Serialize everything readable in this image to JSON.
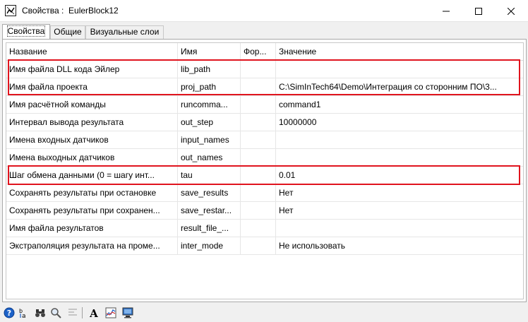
{
  "window": {
    "title": "Свойства :  EulerBlock12"
  },
  "tabs": [
    {
      "label": "Свойства"
    },
    {
      "label": "Общие"
    },
    {
      "label": "Визуальные слои"
    }
  ],
  "grid": {
    "columns": [
      "Название",
      "Имя",
      "Фор...",
      "Значение"
    ],
    "rows": [
      {
        "title": "Имя файла DLL кода Эйлер",
        "name": "lib_path",
        "formula": "",
        "value": ""
      },
      {
        "title": "Имя файла проекта",
        "name": "proj_path",
        "formula": "",
        "value": "C:\\SimInTech64\\Demo\\Интеграция со сторонним ПО\\3..."
      },
      {
        "title": "Имя расчётной команды",
        "name": "runcomma...",
        "formula": "",
        "value": "command1"
      },
      {
        "title": "Интервал вывода результата",
        "name": "out_step",
        "formula": "",
        "value": "10000000"
      },
      {
        "title": "Имена входных датчиков",
        "name": "input_names",
        "formula": "",
        "value": ""
      },
      {
        "title": "Имена выходных датчиков",
        "name": "out_names",
        "formula": "",
        "value": ""
      },
      {
        "title": "Шаг обмена данными (0 = шагу инт...",
        "name": "tau",
        "formula": "",
        "value": "0.01"
      },
      {
        "title": "Сохранять результаты при остановке",
        "name": "save_results",
        "formula": "",
        "value": "Нет"
      },
      {
        "title": "Сохранять результаты при сохранен...",
        "name": "save_restar...",
        "formula": "",
        "value": "Нет"
      },
      {
        "title": "Имя файла результатов",
        "name": "result_file_...",
        "formula": "",
        "value": ""
      },
      {
        "title": "Экстраполяция результата на проме...",
        "name": "inter_mode",
        "formula": "",
        "value": "Не использовать"
      }
    ]
  },
  "highlight_color": "#e0141e",
  "toolbar": {
    "icons": [
      "help-icon",
      "sort-az-icon",
      "binoculars-icon",
      "magnifier-icon",
      "font-icon",
      "chart-icon",
      "monitor-icon"
    ]
  }
}
